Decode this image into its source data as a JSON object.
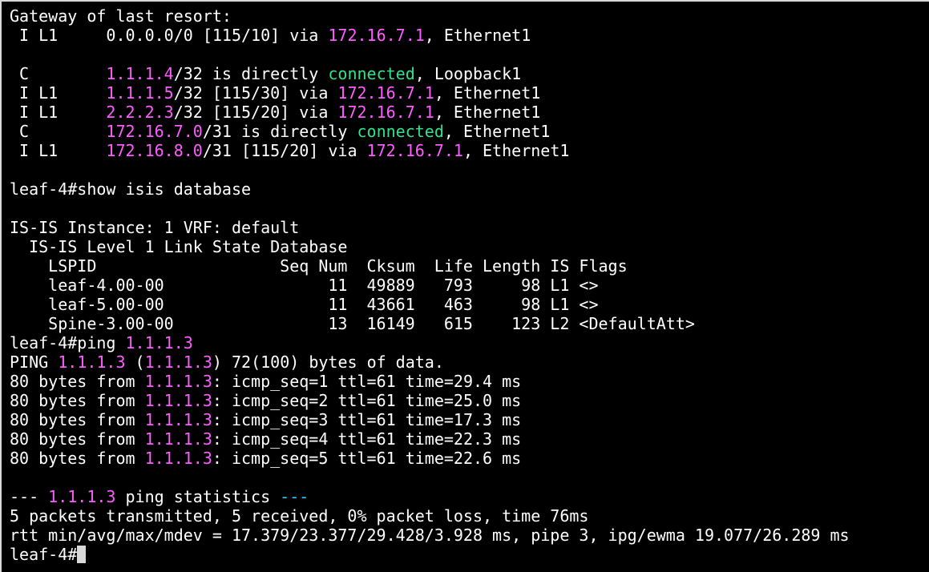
{
  "colors": {
    "background": "#000000",
    "text": "#ffffff",
    "ip_magenta": "#ff5cff",
    "connected_green": "#33e08c",
    "cursor": "#d9d9d9"
  },
  "terminal": {
    "prompt": "leaf-4#",
    "lines": [
      {
        "segments": [
          {
            "text": "Gateway of last resort:"
          }
        ]
      },
      {
        "segments": [
          {
            "text": " I L1     0.0.0.0/0 [115/10] via "
          },
          {
            "text": "172.16.7.1",
            "color": "#ff5cff"
          },
          {
            "text": ", Ethernet1"
          }
        ]
      },
      {
        "segments": [
          {
            "text": ""
          }
        ]
      },
      {
        "segments": [
          {
            "text": " C        "
          },
          {
            "text": "1.1.1.4",
            "color": "#ff5cff"
          },
          {
            "text": "/32 is directly "
          },
          {
            "text": "connected",
            "color": "#33e08c"
          },
          {
            "text": ", Loopback1"
          }
        ]
      },
      {
        "segments": [
          {
            "text": " I L1     "
          },
          {
            "text": "1.1.1.5",
            "color": "#ff5cff"
          },
          {
            "text": "/32 [115/30] via "
          },
          {
            "text": "172.16.7.1",
            "color": "#ff5cff"
          },
          {
            "text": ", Ethernet1"
          }
        ]
      },
      {
        "segments": [
          {
            "text": " I L1     "
          },
          {
            "text": "2.2.2.3",
            "color": "#ff5cff"
          },
          {
            "text": "/32 [115/20] via "
          },
          {
            "text": "172.16.7.1",
            "color": "#ff5cff"
          },
          {
            "text": ", Ethernet1"
          }
        ]
      },
      {
        "segments": [
          {
            "text": " C        "
          },
          {
            "text": "172.16.7.0",
            "color": "#ff5cff"
          },
          {
            "text": "/31 is directly "
          },
          {
            "text": "connected",
            "color": "#33e08c"
          },
          {
            "text": ", Ethernet1"
          }
        ]
      },
      {
        "segments": [
          {
            "text": " I L1     "
          },
          {
            "text": "172.16.8.0",
            "color": "#ff5cff"
          },
          {
            "text": "/31 [115/20] via "
          },
          {
            "text": "172.16.7.1",
            "color": "#ff5cff"
          },
          {
            "text": ", Ethernet1"
          }
        ]
      },
      {
        "segments": [
          {
            "text": ""
          }
        ]
      },
      {
        "segments": [
          {
            "text": "leaf-4#show isis database"
          }
        ]
      },
      {
        "segments": [
          {
            "text": ""
          }
        ]
      },
      {
        "segments": [
          {
            "text": "IS-IS Instance: 1 VRF: default"
          }
        ]
      },
      {
        "segments": [
          {
            "text": "  IS-IS Level 1 Link State Database"
          }
        ]
      },
      {
        "segments": [
          {
            "text": "    LSPID                   Seq Num  Cksum  Life Length IS Flags"
          }
        ]
      },
      {
        "segments": [
          {
            "text": "    leaf-4.00-00                 11  49889   793     98 L1 <>"
          }
        ]
      },
      {
        "segments": [
          {
            "text": "    leaf-5.00-00                 11  43661   463     98 L1 <>"
          }
        ]
      },
      {
        "segments": [
          {
            "text": "    Spine-3.00-00                13  16149   615    123 L2 <DefaultAtt>"
          }
        ]
      },
      {
        "segments": [
          {
            "text": "leaf-4#ping "
          },
          {
            "text": "1.1.1.3",
            "color": "#ff5cff"
          }
        ]
      },
      {
        "segments": [
          {
            "text": "PING "
          },
          {
            "text": "1.1.1.3",
            "color": "#ff5cff"
          },
          {
            "text": " ("
          },
          {
            "text": "1.1.1.3",
            "color": "#ff5cff"
          },
          {
            "text": ") 72(100) bytes of data."
          }
        ]
      },
      {
        "segments": [
          {
            "text": "80 bytes from "
          },
          {
            "text": "1.1.1.3",
            "color": "#ff5cff"
          },
          {
            "text": ": icmp_seq=1 ttl=61 time=29.4 ms"
          }
        ]
      },
      {
        "segments": [
          {
            "text": "80 bytes from "
          },
          {
            "text": "1.1.1.3",
            "color": "#ff5cff"
          },
          {
            "text": ": icmp_seq=2 ttl=61 time=25.0 ms"
          }
        ]
      },
      {
        "segments": [
          {
            "text": "80 bytes from "
          },
          {
            "text": "1.1.1.3",
            "color": "#ff5cff"
          },
          {
            "text": ": icmp_seq=3 ttl=61 time=17.3 ms"
          }
        ]
      },
      {
        "segments": [
          {
            "text": "80 bytes from "
          },
          {
            "text": "1.1.1.3",
            "color": "#ff5cff"
          },
          {
            "text": ": icmp_seq=4 ttl=61 time=22.3 ms"
          }
        ]
      },
      {
        "segments": [
          {
            "text": "80 bytes from "
          },
          {
            "text": "1.1.1.3",
            "color": "#ff5cff"
          },
          {
            "text": ": icmp_seq=5 ttl=61 time=22.6 ms"
          }
        ]
      },
      {
        "segments": [
          {
            "text": ""
          }
        ]
      },
      {
        "segments": [
          {
            "text": "--- "
          },
          {
            "text": "1.1.1.3",
            "color": "#ff5cff"
          },
          {
            "text": " ping statistics "
          },
          {
            "text": "---",
            "color": "#33c3ff"
          }
        ]
      },
      {
        "segments": [
          {
            "text": "5 packets transmitted, 5 received, 0% packet loss, time 76ms"
          }
        ]
      },
      {
        "segments": [
          {
            "text": "rtt min/avg/max/mdev = 17.379/23.377/29.428/3.928 ms, pipe 3, ipg/ewma 19.077/26.289 ms"
          }
        ]
      }
    ]
  }
}
